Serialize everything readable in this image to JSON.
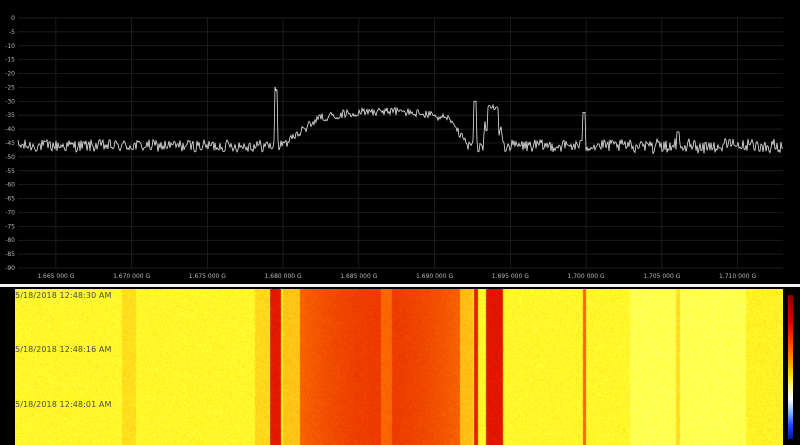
{
  "spectrum": {
    "y_axis": {
      "labels": [
        "0",
        "-5",
        "-10",
        "-15",
        "-20",
        "-25",
        "-30",
        "-35",
        "-40",
        "-45",
        "-50",
        "-55",
        "-60",
        "-65",
        "-70",
        "-75",
        "-80",
        "-85",
        "-90"
      ]
    },
    "x_axis": {
      "labels": [
        "1.665 000 G",
        "1.670 000 G",
        "1.675 000 G",
        "1.680 000 G",
        "1.685 000 G",
        "1.690 000 G",
        "1.695 000 G",
        "1.700 000 G",
        "1.705 000 G",
        "1.710 000 G"
      ]
    },
    "colors": {
      "background": "#000000",
      "grid": "#262626",
      "trace": "#e6e6e6"
    }
  },
  "waterfall": {
    "timestamps": [
      "5/18/2018 12:48:30 AM",
      "5/18/2018 12:48:16 AM",
      "5/18/2018 12:48:01 AM"
    ],
    "colors": {
      "low": "#ffff33",
      "mid": "#ff8c00",
      "high": "#e8140c"
    }
  }
}
